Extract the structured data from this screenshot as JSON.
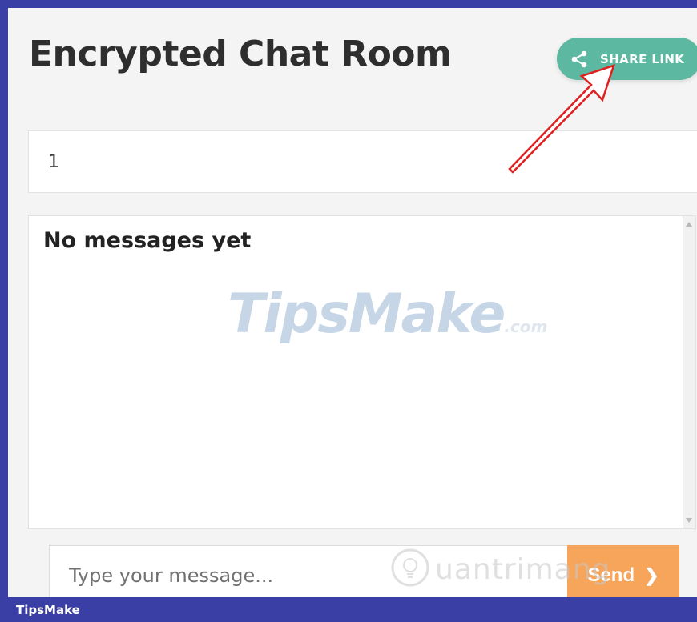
{
  "app": {
    "title": "Encrypted Chat Room",
    "share_button": {
      "label": "SHARE LINK",
      "icon": "share-icon",
      "color": "#5cb8a0"
    },
    "link_field": {
      "value": "1"
    },
    "messages": {
      "empty_text": "No messages yet"
    },
    "composer": {
      "placeholder": "Type your message...",
      "send_label": "Send",
      "send_icon": "chevron-right-icon",
      "send_color": "#f6a55b"
    }
  },
  "watermarks": {
    "center_logo": {
      "main": "TipsMake",
      "suffix": ".com"
    },
    "bottom_logo": {
      "text": "uantrimang",
      "icon": "lightbulb-icon"
    }
  },
  "footer": {
    "brand": "TipsMake",
    "color": "#3a3fa6"
  },
  "annotation": {
    "icon": "arrow-annotation-icon",
    "color": "#e02020"
  }
}
